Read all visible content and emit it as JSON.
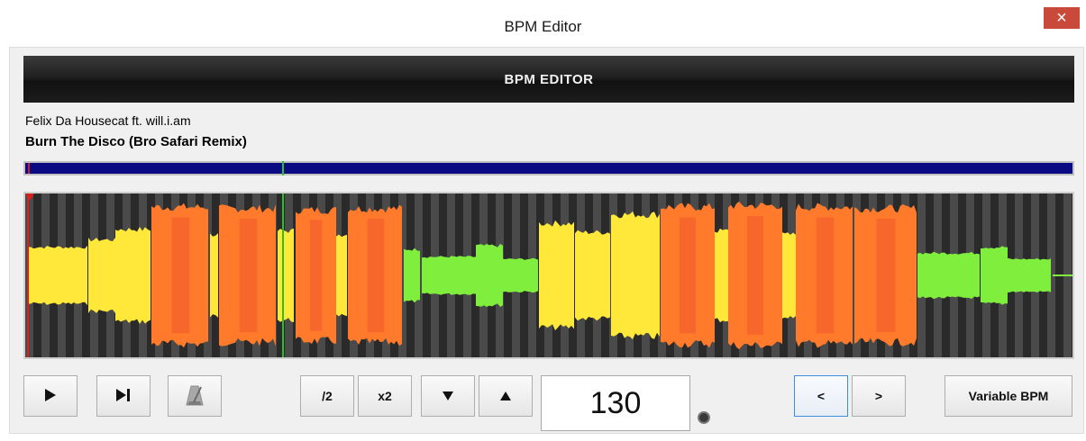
{
  "window": {
    "title": "BPM Editor",
    "close_label": "×"
  },
  "header": {
    "label": "BPM EDITOR"
  },
  "track": {
    "artist": "Felix Da Housecat ft. will.i.am",
    "title": "Burn The Disco (Bro Safari Remix)"
  },
  "overview": {
    "bar_color": "#0a0a82",
    "start_color": "#c81e1e",
    "play_color": "#27c227"
  },
  "waveform": {
    "colors": {
      "low": "#7fee3c",
      "mid": "#ffe83a",
      "high": "#ff7a2a",
      "peak": "#f0562a",
      "playhead": "#27c227",
      "start": "#d42020"
    }
  },
  "controls": {
    "play_icon": "play-icon",
    "skip_icon": "skip-to-end-icon",
    "metronome_icon": "metronome-icon",
    "half_label": "/2",
    "double_label": "x2",
    "down_icon": "triangle-down-icon",
    "up_icon": "triangle-up-icon",
    "bpm_value": "130",
    "prev_label": "<",
    "next_label": ">",
    "variable_label": "Variable BPM"
  }
}
